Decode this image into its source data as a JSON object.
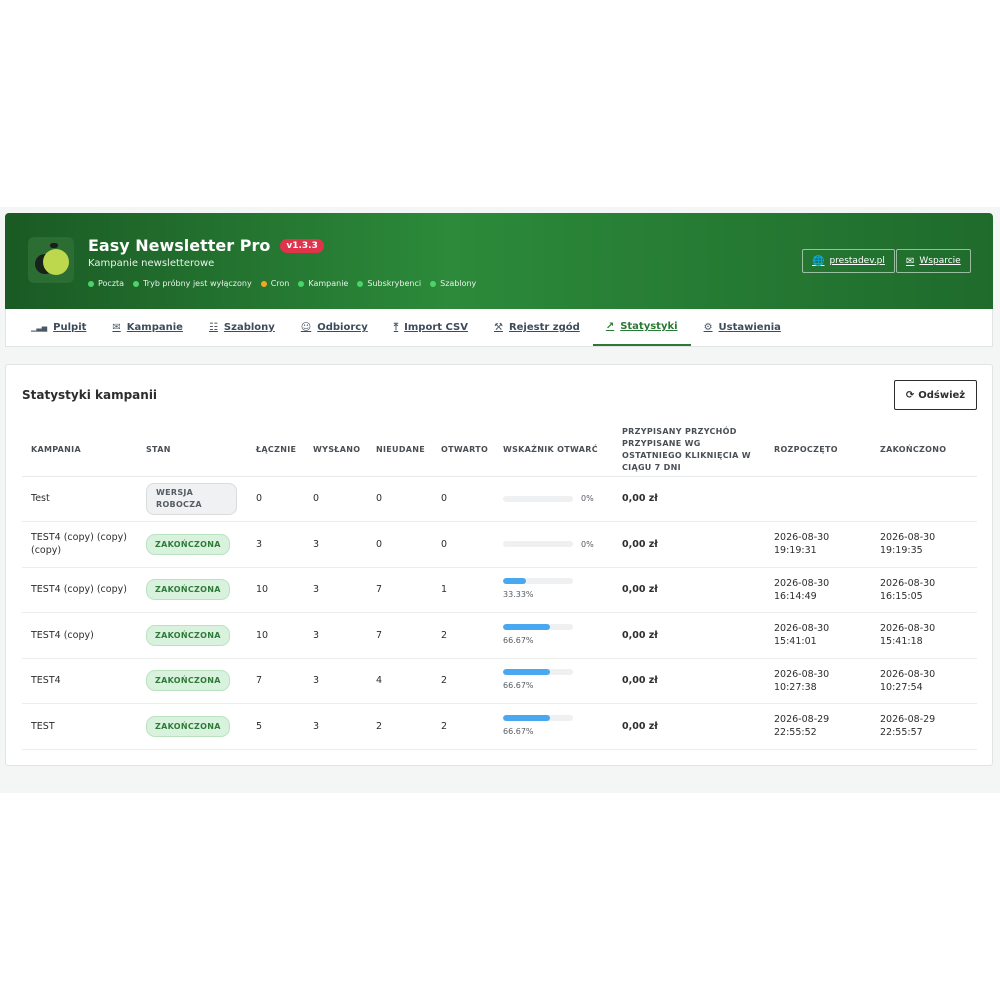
{
  "header": {
    "title": "Easy Newsletter Pro",
    "version": "v1.3.3",
    "subtitle": "Kampanie newsletterowe",
    "statuses": [
      {
        "label": "Poczta",
        "color": "#4cd36a"
      },
      {
        "label": "Tryb próbny jest wyłączony",
        "color": "#4cd36a"
      },
      {
        "label": "Cron",
        "color": "#f5a623"
      },
      {
        "label": "Kampanie",
        "color": "#4cd36a"
      },
      {
        "label": "Subskrybenci",
        "color": "#4cd36a"
      },
      {
        "label": "Szablony",
        "color": "#4cd36a"
      }
    ],
    "link_site": "prestadev.pl",
    "link_support": "Wsparcie"
  },
  "tabs": [
    {
      "label": "Pulpit",
      "icon": "chart-bar-icon"
    },
    {
      "label": "Kampanie",
      "icon": "envelope-icon"
    },
    {
      "label": "Szablony",
      "icon": "file-icon"
    },
    {
      "label": "Odbiorcy",
      "icon": "users-icon"
    },
    {
      "label": "Import CSV",
      "icon": "upload-icon"
    },
    {
      "label": "Rejestr zgód",
      "icon": "gavel-icon"
    },
    {
      "label": "Statystyki",
      "icon": "line-chart-icon",
      "active": true
    },
    {
      "label": "Ustawienia",
      "icon": "cogs-icon"
    }
  ],
  "panel": {
    "title": "Statystyki kampanii",
    "refresh_label": "Odśwież"
  },
  "table": {
    "headers": {
      "campaign": "KAMPANIA",
      "state": "STAN",
      "total": "ŁĄCZNIE",
      "sent": "WYSŁANO",
      "failed": "NIEUDANE",
      "opened": "OTWARTO",
      "open_rate": "WSKAŹNIK OTWARĆ",
      "revenue_line1": "PRZYPISANY PRZYCHÓD",
      "revenue_line2": "PRZYPISANE WG OSTATNIEGO KLIKNIĘCIA W CIĄGU 7 DNI",
      "started": "ROZPOCZĘTO",
      "finished": "ZAKOŃCZONO"
    },
    "rows": [
      {
        "campaign": "Test",
        "state": "WERSJA ROBOCZA",
        "state_type": "draft",
        "total": "0",
        "sent": "0",
        "failed": "0",
        "opened": "0",
        "rate": 0,
        "rate_label": "0%",
        "revenue": "0,00 zł",
        "started_date": "",
        "started_time": "",
        "finished_date": "",
        "finished_time": ""
      },
      {
        "campaign": "TEST4 (copy) (copy) (copy)",
        "state": "ZAKOŃCZONA",
        "state_type": "done",
        "total": "3",
        "sent": "3",
        "failed": "0",
        "opened": "0",
        "rate": 0,
        "rate_label": "0%",
        "revenue": "0,00 zł",
        "started_date": "2026-08-30",
        "started_time": "19:19:31",
        "finished_date": "2026-08-30",
        "finished_time": "19:19:35"
      },
      {
        "campaign": "TEST4 (copy) (copy)",
        "state": "ZAKOŃCZONA",
        "state_type": "done",
        "total": "10",
        "sent": "3",
        "failed": "7",
        "opened": "1",
        "rate": 33.33,
        "rate_label": "33.33%",
        "revenue": "0,00 zł",
        "started_date": "2026-08-30",
        "started_time": "16:14:49",
        "finished_date": "2026-08-30",
        "finished_time": "16:15:05"
      },
      {
        "campaign": "TEST4 (copy)",
        "state": "ZAKOŃCZONA",
        "state_type": "done",
        "total": "10",
        "sent": "3",
        "failed": "7",
        "opened": "2",
        "rate": 66.67,
        "rate_label": "66.67%",
        "revenue": "0,00 zł",
        "started_date": "2026-08-30",
        "started_time": "15:41:01",
        "finished_date": "2026-08-30",
        "finished_time": "15:41:18"
      },
      {
        "campaign": "TEST4",
        "state": "ZAKOŃCZONA",
        "state_type": "done",
        "total": "7",
        "sent": "3",
        "failed": "4",
        "opened": "2",
        "rate": 66.67,
        "rate_label": "66.67%",
        "revenue": "0,00 zł",
        "started_date": "2026-08-30",
        "started_time": "10:27:38",
        "finished_date": "2026-08-30",
        "finished_time": "10:27:54"
      },
      {
        "campaign": "TEST",
        "state": "ZAKOŃCZONA",
        "state_type": "done",
        "total": "5",
        "sent": "3",
        "failed": "2",
        "opened": "2",
        "rate": 66.67,
        "rate_label": "66.67%",
        "revenue": "0,00 zł",
        "started_date": "2026-08-29",
        "started_time": "22:55:52",
        "finished_date": "2026-08-29",
        "finished_time": "22:55:57"
      }
    ]
  },
  "colors": {
    "brand_green": "#2a7a35",
    "version_badge": "#e0334c",
    "progress_fill": "#4aa8f0",
    "badge_done_bg": "#d9f2dd"
  }
}
